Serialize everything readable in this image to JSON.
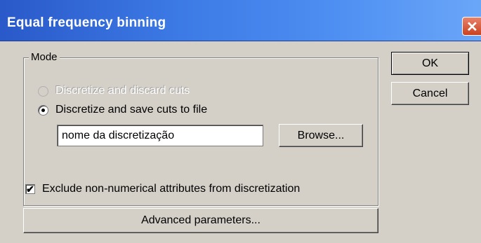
{
  "window": {
    "title": "Equal frequency binning",
    "close_symbol": "✕"
  },
  "mode_group": {
    "label": "Mode",
    "options": [
      {
        "label": "Discretize and discard cuts",
        "selected": false,
        "enabled": false
      },
      {
        "label": "Discretize and save cuts to file",
        "selected": true,
        "enabled": true
      }
    ]
  },
  "file_input": {
    "value": "nome da discretização"
  },
  "buttons": {
    "browse": "Browse...",
    "ok": "OK",
    "cancel": "Cancel",
    "advanced": "Advanced parameters..."
  },
  "exclude_checkbox": {
    "label": "Exclude non-numerical attributes from discretization",
    "checked": true,
    "check_mark": "✔"
  },
  "icons": [
    "close-icon",
    "radio-icon",
    "checkbox-icon"
  ]
}
